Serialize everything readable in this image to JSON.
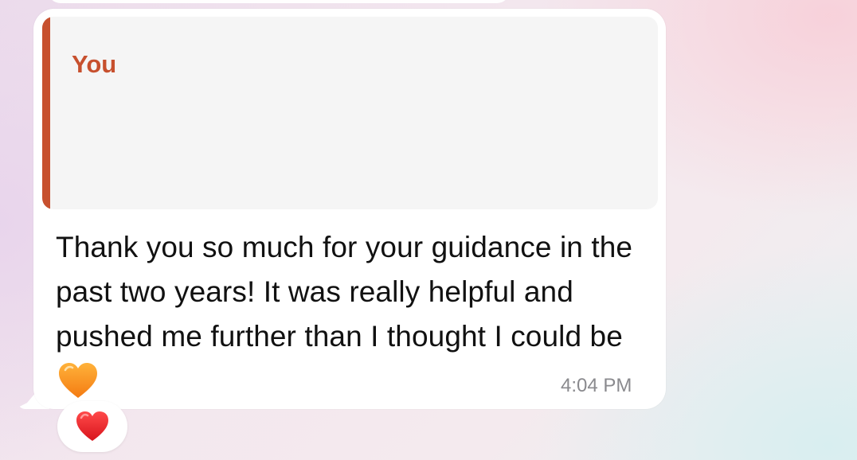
{
  "message": {
    "reply_quote": {
      "author": "You",
      "accent_color": "#c7502e"
    },
    "text": "Thank you so much for your guidance in the past two years! It was really helpful and pushed me further than I thought I could be",
    "trailing_emoji": "orange-heart-icon",
    "timestamp": "4:04 PM",
    "bubble_color": "#ffffff"
  },
  "reactions": [
    {
      "icon": "red-heart-icon"
    }
  ],
  "colors": {
    "text": "#111111",
    "timestamp": "#8a8a8e",
    "quote_background": "#f5f5f5"
  }
}
